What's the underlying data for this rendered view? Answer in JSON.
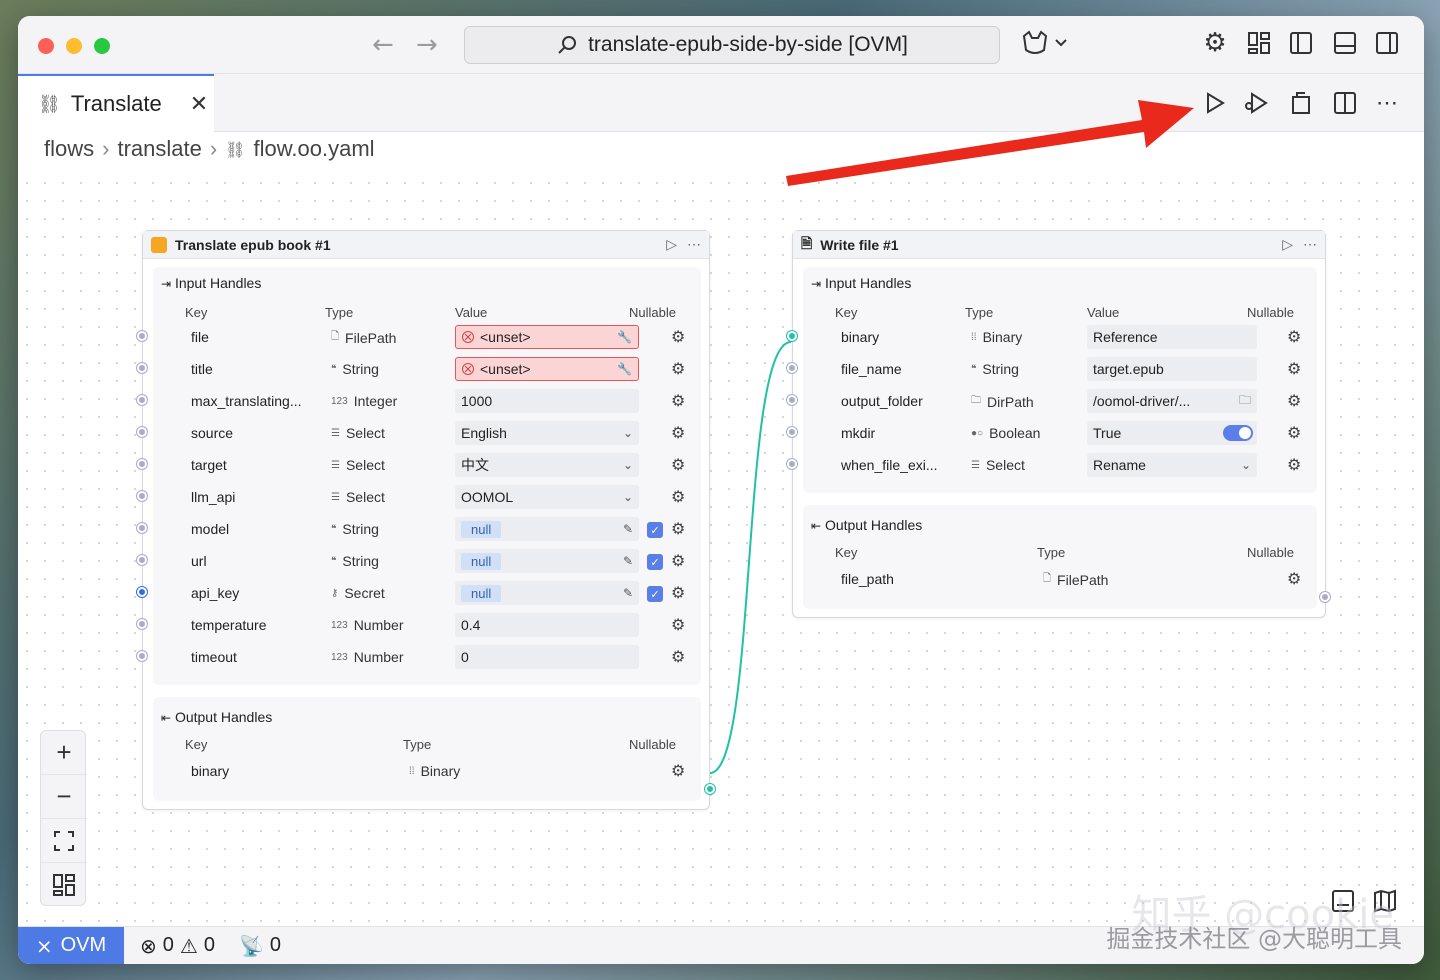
{
  "window": {
    "search_text": "translate-epub-side-by-side [OVM]"
  },
  "tab": {
    "label": "Translate",
    "close": "✕"
  },
  "breadcrumb": {
    "items": [
      "flows",
      "translate",
      "flow.oo.yaml"
    ]
  },
  "colors": {
    "accent": "#4e7ae6",
    "error": "#e55757",
    "connection": "#1fc2a6",
    "arrow": "#e8291c"
  },
  "node1": {
    "title": "Translate epub book #1",
    "input_handles_title": "Input Handles",
    "output_handles_title": "Output Handles",
    "columns": {
      "key": "Key",
      "type": "Type",
      "value": "Value",
      "nullable": "Nullable"
    },
    "inputs": [
      {
        "key": "file",
        "type": "FilePath",
        "value": "<unset>",
        "state": "error"
      },
      {
        "key": "title",
        "type": "String",
        "value": "<unset>",
        "state": "error"
      },
      {
        "key": "max_translating...",
        "type": "Integer",
        "value": "1000"
      },
      {
        "key": "source",
        "type": "Select",
        "value": "English",
        "select": true
      },
      {
        "key": "target",
        "type": "Select",
        "value": "中文",
        "select": true
      },
      {
        "key": "llm_api",
        "type": "Select",
        "value": "OOMOL",
        "select": true
      },
      {
        "key": "model",
        "type": "String",
        "value": "null",
        "nullable": true
      },
      {
        "key": "url",
        "type": "String",
        "value": "null",
        "nullable": true
      },
      {
        "key": "api_key",
        "type": "Secret",
        "value": "null",
        "nullable": true
      },
      {
        "key": "temperature",
        "type": "Number",
        "value": "0.4"
      },
      {
        "key": "timeout",
        "type": "Number",
        "value": "0"
      }
    ],
    "outputs": [
      {
        "key": "binary",
        "type": "Binary"
      }
    ]
  },
  "node2": {
    "title": "Write file #1",
    "input_handles_title": "Input Handles",
    "output_handles_title": "Output Handles",
    "columns": {
      "key": "Key",
      "type": "Type",
      "value": "Value",
      "nullable": "Nullable"
    },
    "inputs": [
      {
        "key": "binary",
        "type": "Binary",
        "value": "Reference"
      },
      {
        "key": "file_name",
        "type": "String",
        "value": "target.epub"
      },
      {
        "key": "output_folder",
        "type": "DirPath",
        "value": "/oomol-driver/..."
      },
      {
        "key": "mkdir",
        "type": "Boolean",
        "value": "True",
        "toggle": true
      },
      {
        "key": "when_file_exi...",
        "type": "Select",
        "value": "Rename",
        "select": true
      }
    ],
    "outputs": [
      {
        "key": "file_path",
        "type": "FilePath"
      }
    ]
  },
  "statusbar": {
    "env": "OVM",
    "errors": "0",
    "warnings": "0",
    "ports": "0"
  },
  "watermark": {
    "line1": "知乎 @cookie",
    "line2": "掘金技术社区 @大聪明工具"
  }
}
